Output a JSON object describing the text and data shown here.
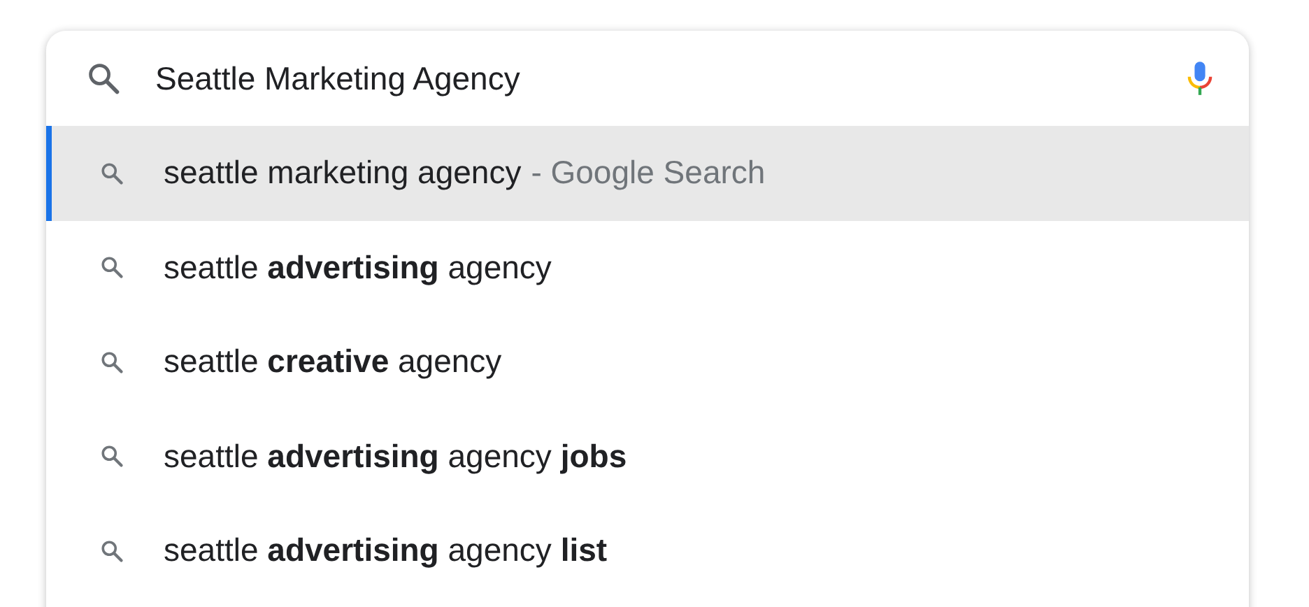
{
  "search": {
    "value": "Seattle Marketing Agency"
  },
  "suggestions": [
    {
      "text": "seattle marketing agency",
      "suffix": "- Google Search",
      "selected": true
    },
    {
      "text": "seattle **advertising** agency",
      "selected": false
    },
    {
      "text": "seattle **creative** agency",
      "selected": false
    },
    {
      "text": "seattle **advertising** agency **jobs**",
      "selected": false
    },
    {
      "text": "seattle **advertising** agency **list**",
      "selected": false
    }
  ]
}
